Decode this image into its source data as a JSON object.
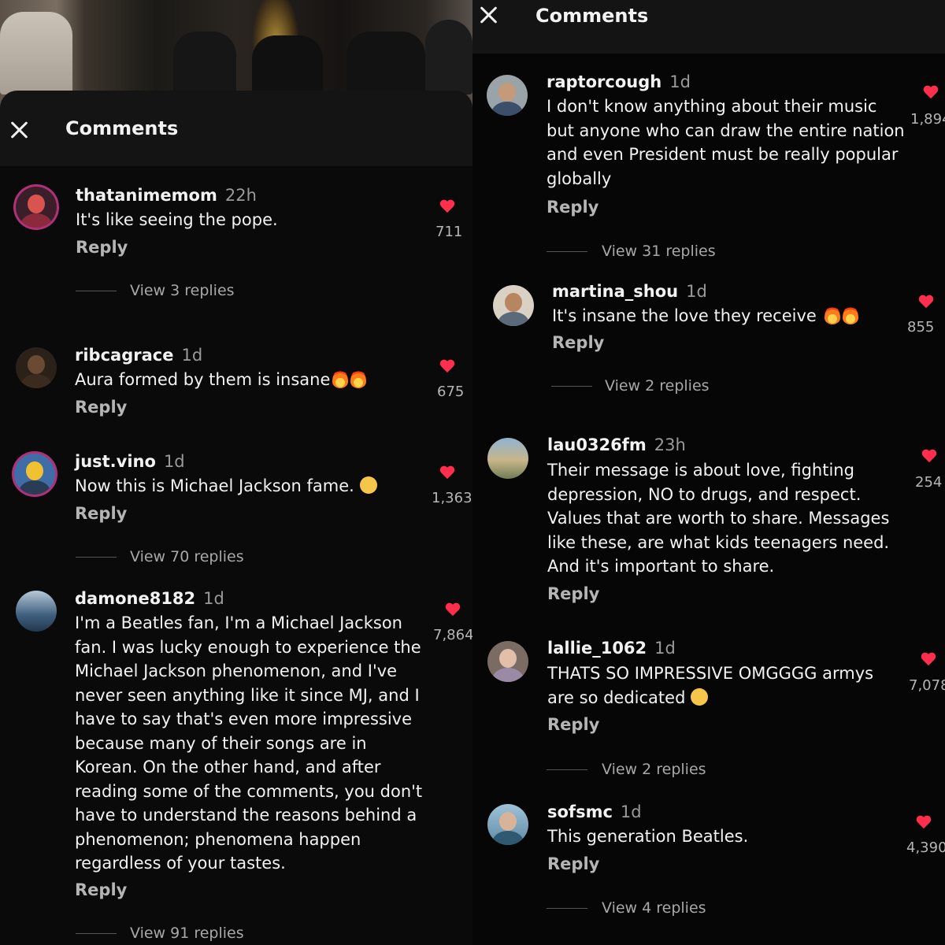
{
  "left": {
    "header": {
      "title": "Comments",
      "close_icon": "close-icon"
    },
    "comments": [
      {
        "username": "thatanimemom",
        "time": "22h",
        "text": "It's like seeing the pope.",
        "reply": "Reply",
        "likes": "711",
        "view_replies": "View 3 replies"
      },
      {
        "username": "ribcagrace",
        "time": "1d",
        "text": "Aura formed by them is insane",
        "emoji": "fire fire",
        "reply": "Reply",
        "likes": "675"
      },
      {
        "username": "just.vino",
        "time": "1d",
        "text": "Now this is Michael Jackson fame.",
        "emoji": "face-emoji",
        "reply": "Reply",
        "likes": "1,363",
        "view_replies": "View 70 replies"
      },
      {
        "username": "damone8182",
        "time": "1d",
        "text_lines": [
          "I'm a Beatles fan, I'm a Michael Jackson",
          "fan. I was lucky enough to experience the",
          "Michael Jackson phenomenon, and I've",
          "never seen anything like it since MJ, and I",
          "have to say that's even more impressive",
          "because many of their songs are in",
          "Korean. On the other hand, and after",
          "reading some of the comments, you don't",
          "have to understand the reasons behind a",
          "phenomenon; phenomena happen",
          "regardless of your tastes."
        ],
        "reply": "Reply",
        "likes": "7,864",
        "view_replies": "View 91 replies"
      }
    ]
  },
  "right": {
    "header": {
      "title": "Comments",
      "close_icon": "close-icon"
    },
    "comments": [
      {
        "username": "raptorcough",
        "time": "1d",
        "text_lines": [
          "I don't know anything about their music",
          "but anyone who can draw the entire nation",
          "and even President must be really popular",
          "globally"
        ],
        "reply": "Reply",
        "likes": "1,894",
        "view_replies": "View 31 replies"
      },
      {
        "username": "martina_shou",
        "time": "1d",
        "text": "It's insane the love they receive",
        "emoji": "fire fire",
        "reply": "Reply",
        "likes": "855",
        "view_replies": "View 2 replies"
      },
      {
        "username": "lau0326fm",
        "time": "23h",
        "text_lines": [
          "Their message is about love, fighting",
          "depression, NO to drugs, and respect.",
          "Values that are worth to share. Messages",
          "like these, are what kids teenagers  need.",
          "And it's important to share."
        ],
        "reply": "Reply",
        "likes": "254"
      },
      {
        "username": "lallie_1062",
        "time": "1d",
        "text_lines": [
          "THATS SO IMPRESSIVE OMGGGG armys",
          "are so dedicated"
        ],
        "emoji": "face-emoji",
        "reply": "Reply",
        "likes": "7,078",
        "view_replies": "View 2 replies"
      },
      {
        "username": "sofsmc",
        "time": "1d",
        "text": "This generation Beatles.",
        "reply": "Reply",
        "likes": "4,390",
        "view_replies": "View 4 replies"
      }
    ]
  },
  "colors": {
    "heart": "#ff2e4d",
    "background": "#000000",
    "muted": "#9a9a9a"
  }
}
